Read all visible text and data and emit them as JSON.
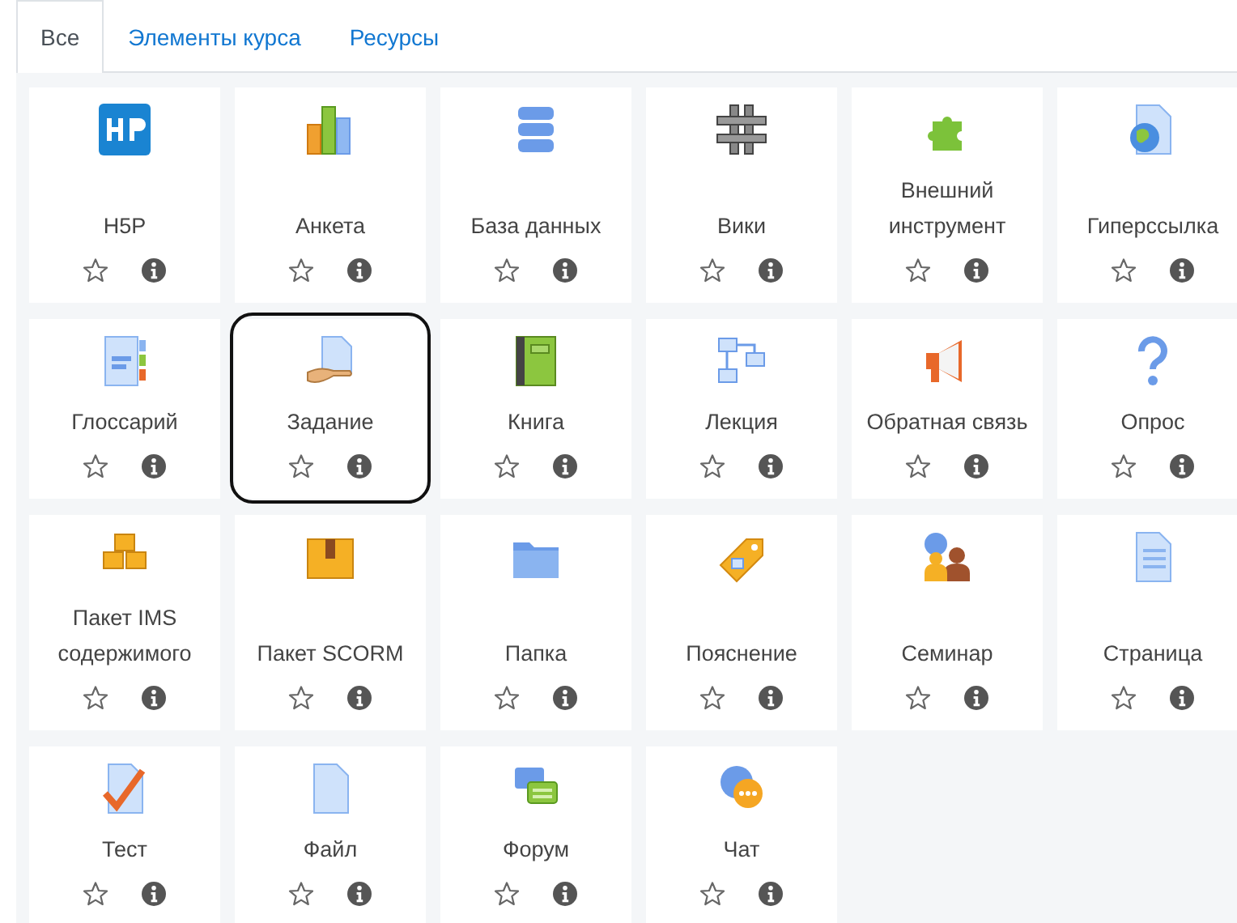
{
  "tabs": [
    {
      "label": "Все",
      "selected": true
    },
    {
      "label": "Элементы курса",
      "selected": false
    },
    {
      "label": "Ресурсы",
      "selected": false
    }
  ],
  "items": [
    {
      "name": "H5P",
      "starred": false,
      "highlighted": false
    },
    {
      "name": "Анкета",
      "starred": false,
      "highlighted": false
    },
    {
      "name": "База данных",
      "starred": false,
      "highlighted": false
    },
    {
      "name": "Вики",
      "starred": false,
      "highlighted": false
    },
    {
      "name": "Внешний инструмент",
      "starred": false,
      "highlighted": false
    },
    {
      "name": "Гиперссылка",
      "starred": false,
      "highlighted": false
    },
    {
      "name": "Глоссарий",
      "starred": false,
      "highlighted": false
    },
    {
      "name": "Задание",
      "starred": false,
      "highlighted": true
    },
    {
      "name": "Книга",
      "starred": false,
      "highlighted": false
    },
    {
      "name": "Лекция",
      "starred": false,
      "highlighted": false
    },
    {
      "name": "Обратная связь",
      "starred": false,
      "highlighted": false
    },
    {
      "name": "Опрос",
      "starred": false,
      "highlighted": false
    },
    {
      "name": "Пакет IMS содержимого",
      "starred": false,
      "highlighted": false
    },
    {
      "name": "Пакет SCORM",
      "starred": false,
      "highlighted": false
    },
    {
      "name": "Папка",
      "starred": false,
      "highlighted": false
    },
    {
      "name": "Пояснение",
      "starred": false,
      "highlighted": false
    },
    {
      "name": "Семинар",
      "starred": false,
      "highlighted": false
    },
    {
      "name": "Страница",
      "starred": false,
      "highlighted": false
    },
    {
      "name": "Тест",
      "starred": false,
      "highlighted": false
    },
    {
      "name": "Файл",
      "starred": false,
      "highlighted": false
    },
    {
      "name": "Форум",
      "starred": false,
      "highlighted": false
    },
    {
      "name": "Чат",
      "starred": false,
      "highlighted": false
    }
  ]
}
